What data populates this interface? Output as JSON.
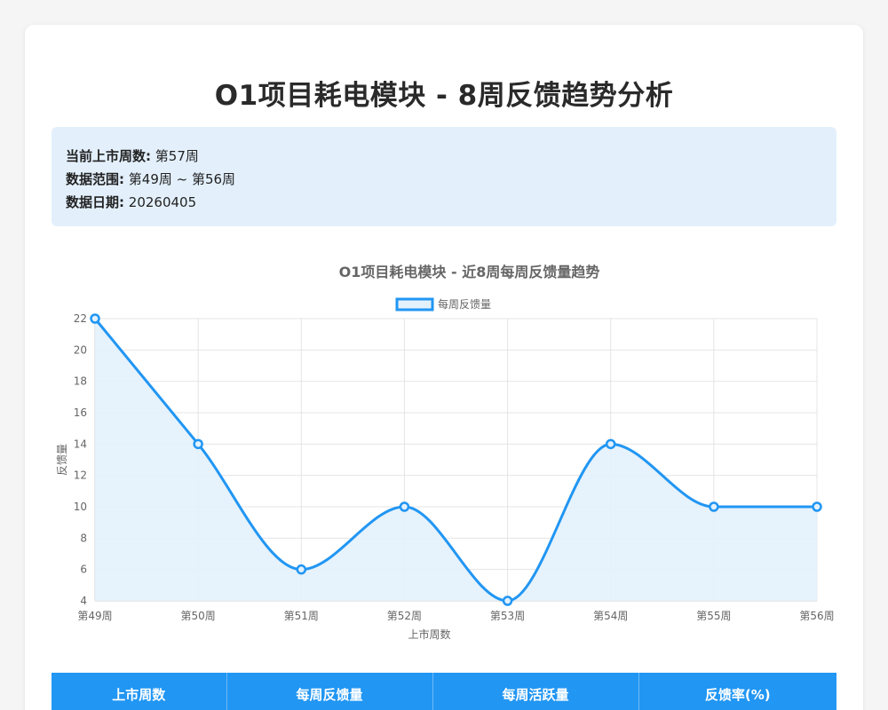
{
  "page": {
    "title": "O1项目耗电模块 - 8周反馈趋势分析"
  },
  "info": {
    "current_week_label": "当前上市周数:",
    "current_week_value": "第57周",
    "range_label": "数据范围:",
    "range_value": "第49周 ~ 第56周",
    "date_label": "数据日期:",
    "date_value": "20260405"
  },
  "colors": {
    "accent": "#2196f3",
    "line": "#2196f3",
    "fill": "#e3f1fc",
    "info_bg": "#e3f0fc"
  },
  "chart_data": {
    "type": "line",
    "title": "O1项目耗电模块 - 近8周每周反馈量趋势",
    "xlabel": "上市周数",
    "ylabel": "反馈量",
    "categories": [
      "第49周",
      "第50周",
      "第51周",
      "第52周",
      "第53周",
      "第54周",
      "第55周",
      "第56周"
    ],
    "series": [
      {
        "name": "每周反馈量",
        "values": [
          22,
          14,
          6,
          10,
          4,
          14,
          10,
          10
        ]
      }
    ],
    "ylim": [
      4,
      22
    ],
    "yticks": [
      4,
      6,
      8,
      10,
      12,
      14,
      16,
      18,
      20,
      22
    ],
    "grid": true,
    "legend": "top",
    "smooth": true,
    "filled": true
  },
  "table": {
    "headers": [
      "上市周数",
      "每周反馈量",
      "每周活跃量",
      "反馈率(%)"
    ]
  }
}
